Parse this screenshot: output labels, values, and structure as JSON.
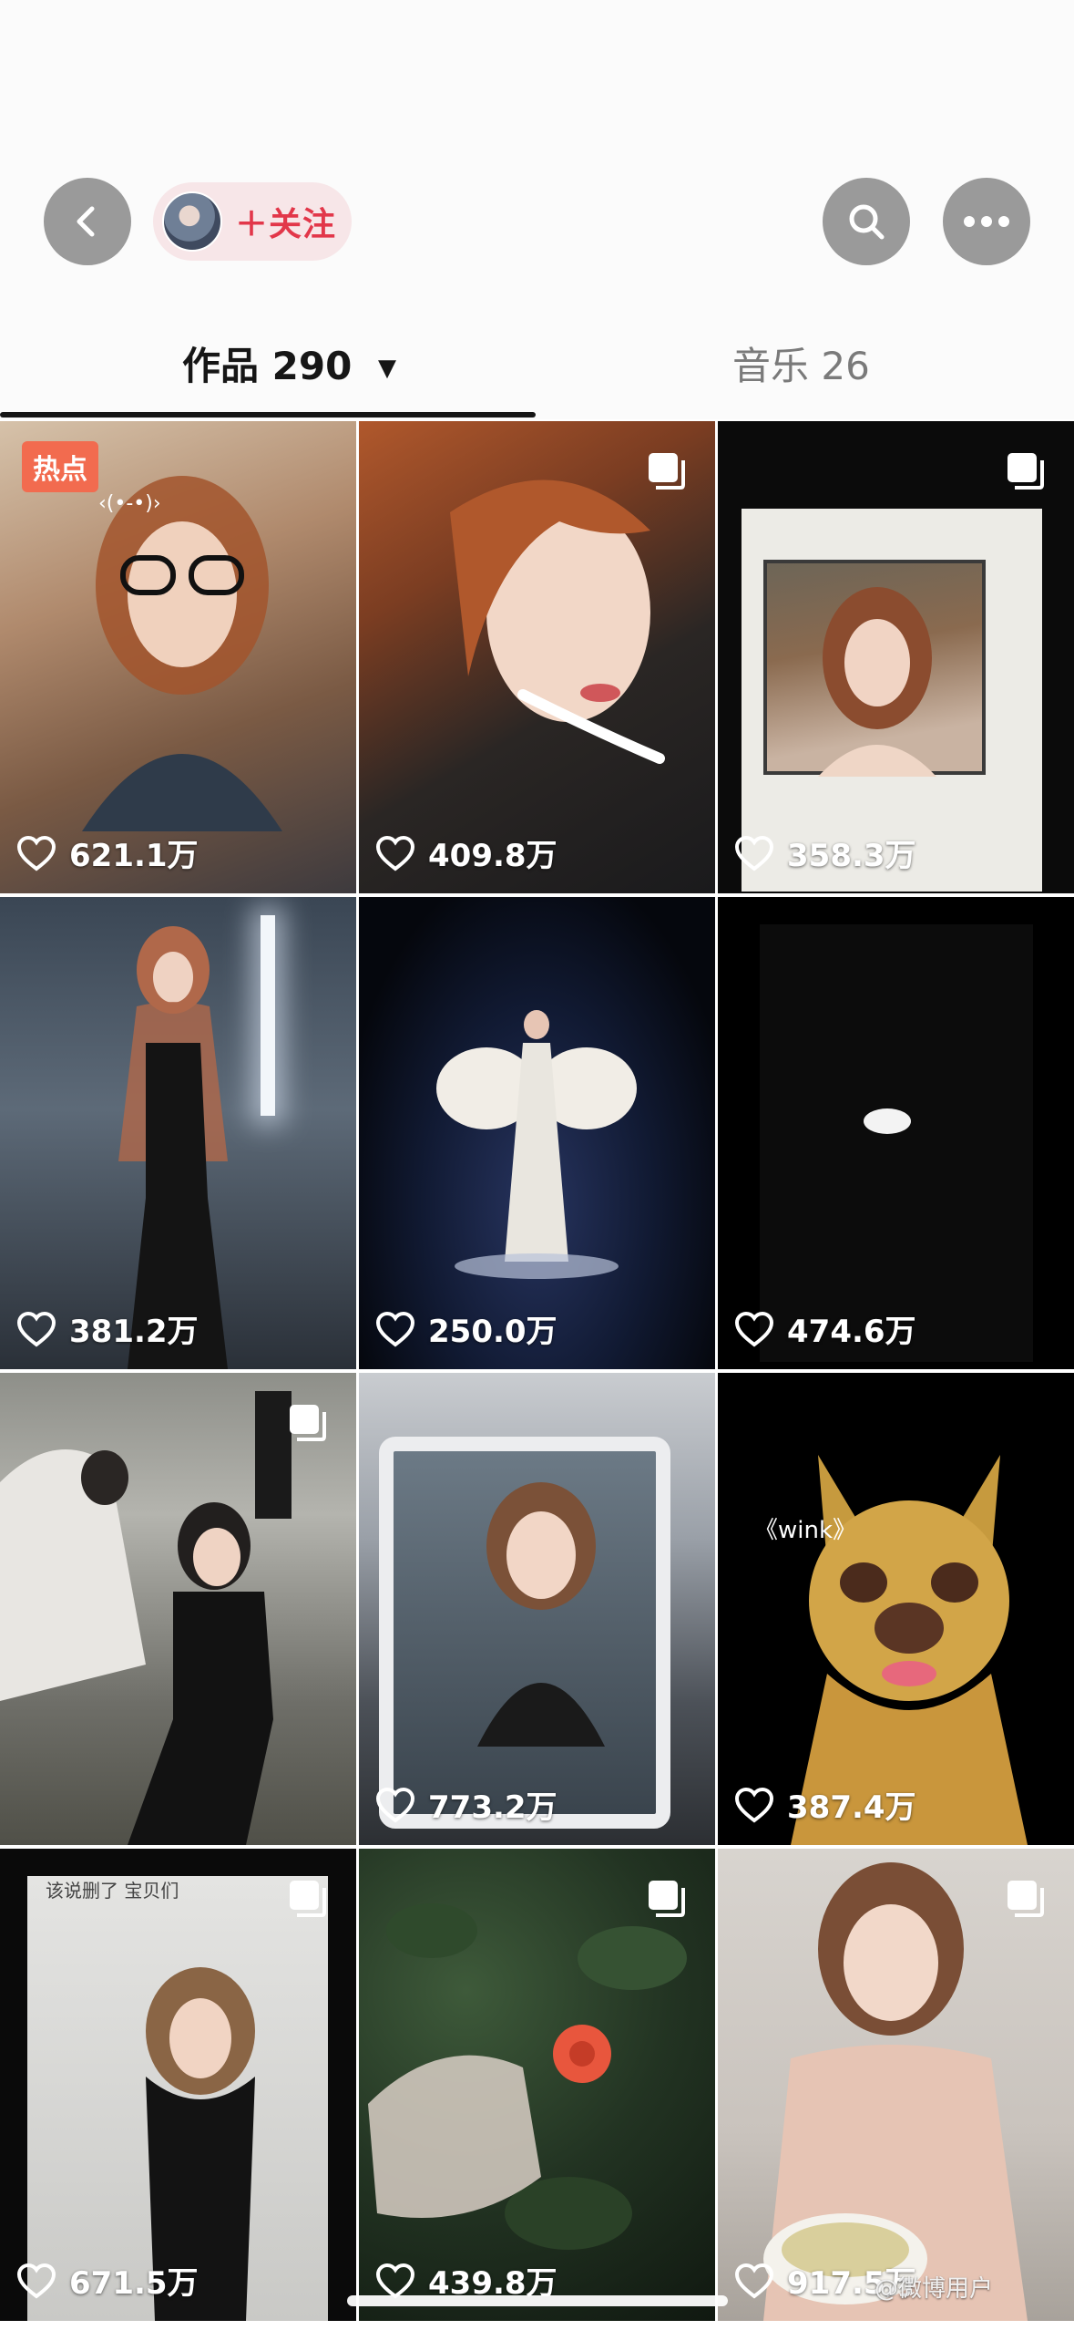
{
  "header": {
    "follow_label": "＋关注"
  },
  "tabs": {
    "works_label": "作品",
    "works_count": "290",
    "works_caret": "▼",
    "music_label": "音乐 26"
  },
  "grid": [
    {
      "likes": "621.1万",
      "badge": "热点",
      "overlay": "‹(•-•)›"
    },
    {
      "likes": "409.8万"
    },
    {
      "likes": "358.3万"
    },
    {
      "likes": "381.2万"
    },
    {
      "likes": "250.0万"
    },
    {
      "likes": "474.6万"
    },
    {
      "likes": ""
    },
    {
      "likes": "773.2万"
    },
    {
      "likes": "387.4万",
      "overlay": "《wink》"
    },
    {
      "likes": "671.5万",
      "overlay": "该说删了 宝贝们"
    },
    {
      "likes": "439.8万"
    },
    {
      "likes": "917.5万"
    }
  ],
  "watermark": "@微博用户"
}
